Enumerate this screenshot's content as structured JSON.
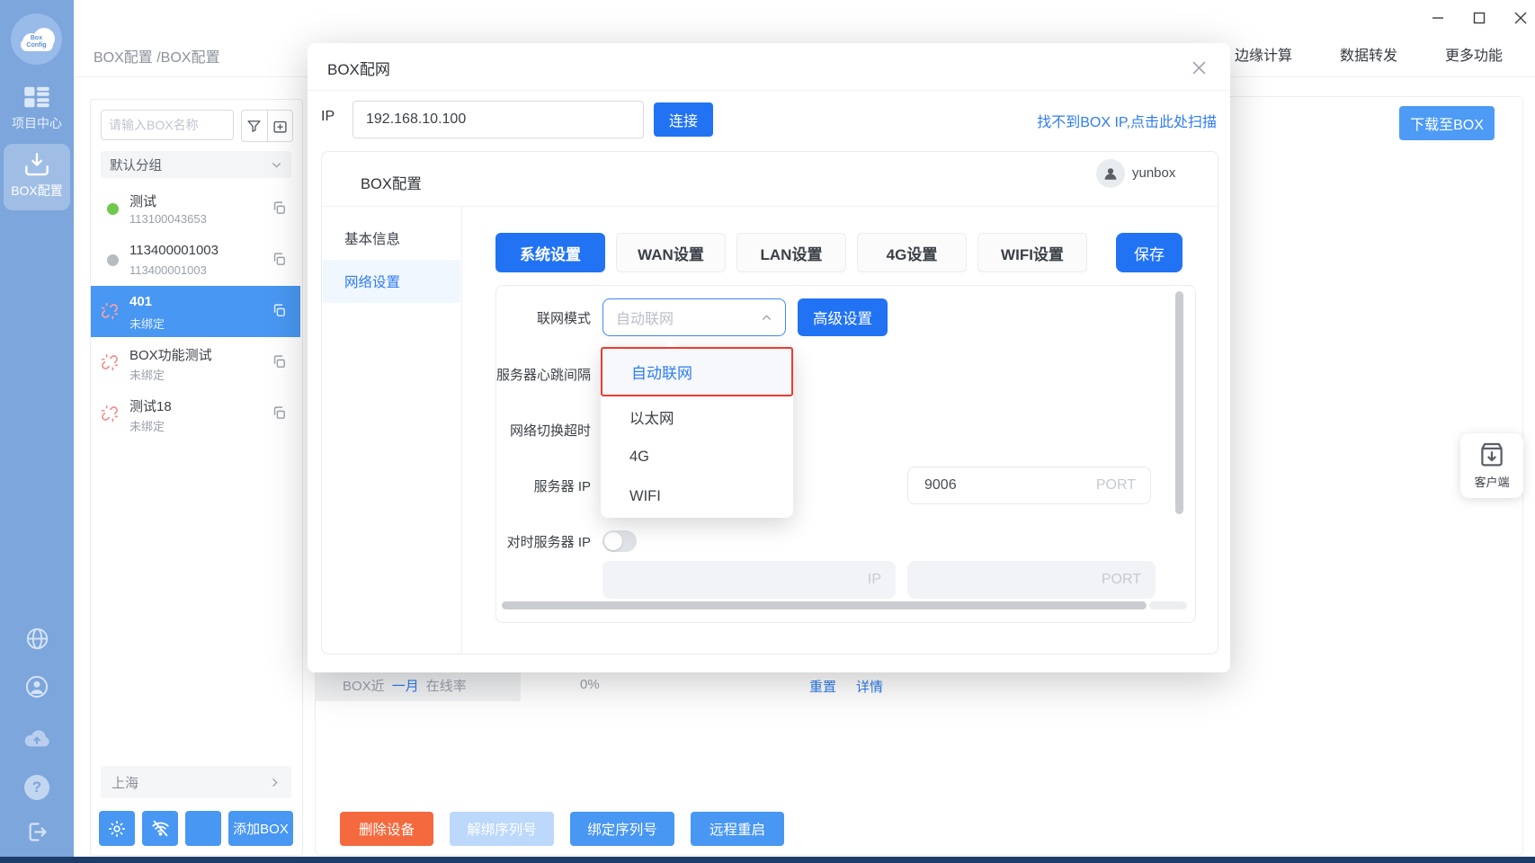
{
  "colors": {
    "primary": "#2173F4",
    "secondary_blue": "#4B99F4",
    "link_blue": "#2E7CF0",
    "danger_orange": "#F4693E",
    "highlight_red": "#EE3B30",
    "sidebar_blue": "#7CA6DC",
    "selected_item_blue": "#4897F2",
    "online_green": "#6FC94A",
    "offline_gray": "#B7BCC2"
  },
  "window": {
    "logo_line1": "Box",
    "logo_line2": "Config"
  },
  "header": {
    "breadcrumb": "BOX配置 /BOX配置",
    "nav": [
      {
        "label": "边缘计算"
      },
      {
        "label": "数据转发"
      },
      {
        "label": "更多功能"
      }
    ]
  },
  "sidebar": {
    "items": [
      {
        "label": "项目中心"
      },
      {
        "label": "BOX配置"
      }
    ],
    "help_glyph": "?"
  },
  "panel": {
    "search_placeholder": "请输入BOX名称",
    "group_label": "默认分组",
    "location": "上海",
    "add_box": "添加BOX",
    "devices": [
      {
        "name": "测试",
        "sub": "113100043653",
        "status": "online"
      },
      {
        "name": "113400001003",
        "sub": "113400001003",
        "status": "offline"
      },
      {
        "name": "401",
        "sub": "未绑定",
        "status": "unbound",
        "selected": true
      },
      {
        "name": "BOX功能测试",
        "sub": "未绑定",
        "status": "unbound"
      },
      {
        "name": "测试18",
        "sub": "未绑定",
        "status": "unbound"
      }
    ]
  },
  "main": {
    "download_button": "下载至BOX",
    "client_widget": "客户端",
    "stats": {
      "prefix": "BOX近",
      "period": "一月",
      "suffix": "在线率",
      "value": "0%",
      "reset": "重置",
      "detail": "详情"
    },
    "actions": [
      {
        "label": "删除设备"
      },
      {
        "label": "解绑序列号"
      },
      {
        "label": "绑定序列号"
      },
      {
        "label": "远程重启"
      }
    ]
  },
  "modal": {
    "title": "BOX配网",
    "ip_label": "IP",
    "ip_value": "192.168.10.100",
    "connect": "连接",
    "scan_link": "找不到BOX IP,点击此处扫描",
    "card": {
      "title": "BOX配置",
      "user": "yunbox",
      "side_tabs": [
        {
          "label": "基本信息"
        },
        {
          "label": "网络设置",
          "active": true
        }
      ],
      "tabs": [
        {
          "label": "系统设置",
          "active": true
        },
        {
          "label": "WAN设置"
        },
        {
          "label": "LAN设置"
        },
        {
          "label": "4G设置"
        },
        {
          "label": "WIFI设置"
        }
      ],
      "save": "保存",
      "form": {
        "mode_label": "联网模式",
        "mode_value": "自动联网",
        "advanced": "高级设置",
        "heartbeat_label": "服务器心跳间隔",
        "timeout_label": "网络切换超时",
        "server_ip_label": "服务器 IP",
        "time_server_label": "对时服务器 IP",
        "port_value": "9006",
        "port_placeholder": "PORT",
        "ip_placeholder": "IP",
        "options": [
          {
            "label": "自动联网",
            "selected": true
          },
          {
            "label": "以太网"
          },
          {
            "label": "4G"
          },
          {
            "label": "WIFI"
          }
        ]
      }
    }
  }
}
